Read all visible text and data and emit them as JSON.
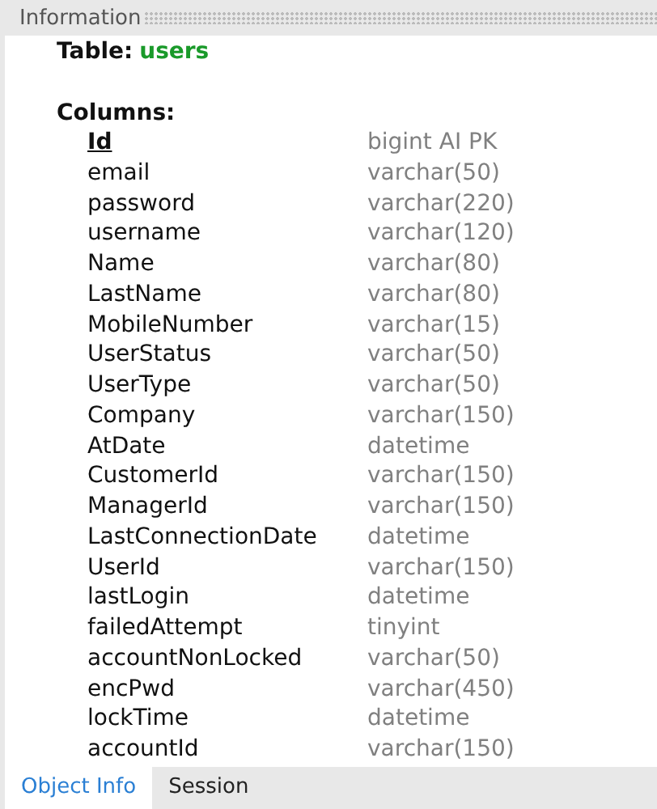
{
  "panel": {
    "title": "Information"
  },
  "table": {
    "label": "Table:",
    "name": "users"
  },
  "columns_heading": "Columns:",
  "columns": [
    {
      "name": "Id",
      "type": "bigint AI PK",
      "primary_key": true
    },
    {
      "name": "email",
      "type": "varchar(50)",
      "primary_key": false
    },
    {
      "name": "password",
      "type": "varchar(220)",
      "primary_key": false
    },
    {
      "name": "username",
      "type": "varchar(120)",
      "primary_key": false
    },
    {
      "name": "Name",
      "type": "varchar(80)",
      "primary_key": false
    },
    {
      "name": "LastName",
      "type": "varchar(80)",
      "primary_key": false
    },
    {
      "name": "MobileNumber",
      "type": "varchar(15)",
      "primary_key": false
    },
    {
      "name": "UserStatus",
      "type": "varchar(50)",
      "primary_key": false
    },
    {
      "name": "UserType",
      "type": "varchar(50)",
      "primary_key": false
    },
    {
      "name": "Company",
      "type": "varchar(150)",
      "primary_key": false
    },
    {
      "name": "AtDate",
      "type": "datetime",
      "primary_key": false
    },
    {
      "name": "CustomerId",
      "type": "varchar(150)",
      "primary_key": false
    },
    {
      "name": "ManagerId",
      "type": "varchar(150)",
      "primary_key": false
    },
    {
      "name": "LastConnectionDate",
      "type": "datetime",
      "primary_key": false
    },
    {
      "name": "UserId",
      "type": "varchar(150)",
      "primary_key": false
    },
    {
      "name": "lastLogin",
      "type": "datetime",
      "primary_key": false
    },
    {
      "name": "failedAttempt",
      "type": "tinyint",
      "primary_key": false
    },
    {
      "name": "accountNonLocked",
      "type": "varchar(50)",
      "primary_key": false
    },
    {
      "name": "encPwd",
      "type": "varchar(450)",
      "primary_key": false
    },
    {
      "name": "lockTime",
      "type": "datetime",
      "primary_key": false
    },
    {
      "name": "accountId",
      "type": "varchar(150)",
      "primary_key": false
    }
  ],
  "tabs": [
    {
      "label": "Object Info",
      "selected": true
    },
    {
      "label": "Session",
      "selected": false
    }
  ]
}
